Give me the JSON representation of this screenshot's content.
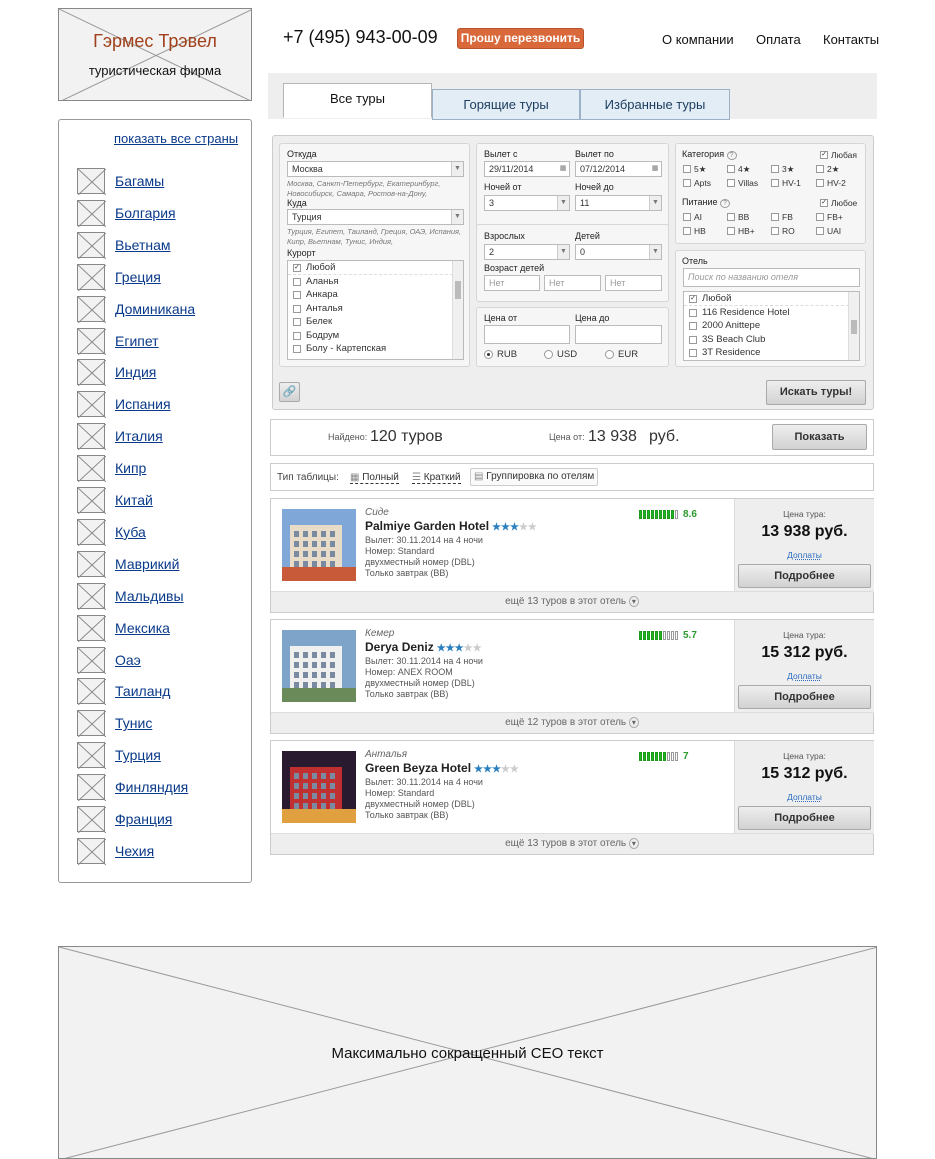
{
  "logo": {
    "title": "Гэрмес Трэвел",
    "subtitle": "туристическая фирма"
  },
  "header": {
    "phone": "+7 (495) 943-00-09",
    "callback_label": "Прошу перезвонить",
    "nav": [
      "О компании",
      "Оплата",
      "Контакты"
    ]
  },
  "sidebar": {
    "show_all_label": "показать все страны",
    "countries": [
      "Багамы",
      "Болгария",
      "Вьетнам",
      "Греция",
      "Доминикана",
      "Египет",
      "Индия",
      "Испания",
      "Италия",
      "Кипр",
      "Китай",
      "Куба",
      "Маврикий",
      "Мальдивы",
      "Мексика",
      "Оаэ",
      "Таиланд",
      "Тунис",
      "Турция",
      "Финляндия",
      "Франция",
      "Чехия"
    ]
  },
  "tabs": [
    "Все туры",
    "Горящие туры",
    "Избранные туры"
  ],
  "search": {
    "from_label": "Откуда",
    "from_value": "Москва",
    "from_hint": "Москва, Санкт-Петербург, Екатеринбург, Новосибирск, Самара, Ростов-на-Дону,",
    "to_label": "Куда",
    "to_value": "Турция",
    "to_hint": "Турция, Египет, Таиланд, Греция, ОАЭ, Испания, Кипр, Вьетнам, Тунис, Индия,",
    "resort_label": "Курорт",
    "resorts": [
      {
        "label": "Любой",
        "checked": true
      },
      {
        "label": "Аланья",
        "checked": false
      },
      {
        "label": "Анкара",
        "checked": false
      },
      {
        "label": "Анталья",
        "checked": false
      },
      {
        "label": "Белек",
        "checked": false
      },
      {
        "label": "Бодрум",
        "checked": false
      },
      {
        "label": "Болу - Картепская",
        "checked": false
      }
    ],
    "date_from_label": "Вылет с",
    "date_from": "29/11/2014",
    "date_to_label": "Вылет по",
    "date_to": "07/12/2014",
    "nights_from_label": "Ночей от",
    "nights_from": "3",
    "nights_to_label": "Ночей до",
    "nights_to": "11",
    "adults_label": "Взрослых",
    "adults": "2",
    "children_label": "Детей",
    "children": "0",
    "child_age_label": "Возраст детей",
    "child_age_placeholder": "Нет",
    "price_from_label": "Цена от",
    "price_to_label": "Цена до",
    "currencies": [
      {
        "label": "RUB",
        "selected": true
      },
      {
        "label": "USD",
        "selected": false
      },
      {
        "label": "EUR",
        "selected": false
      }
    ],
    "category_label": "Категория",
    "category_any": "Любая",
    "categories": [
      "5★",
      "4★",
      "3★",
      "2★",
      "Apts",
      "Villas",
      "HV-1",
      "HV-2"
    ],
    "meal_label": "Питание",
    "meal_any": "Любое",
    "meals": [
      "AI",
      "BB",
      "FB",
      "FB+",
      "HB",
      "HB+",
      "RO",
      "UAI"
    ],
    "hotel_label": "Отель",
    "hotel_placeholder": "Поиск по названию отеля",
    "hotels": [
      {
        "label": "Любой",
        "checked": true
      },
      {
        "label": "116 Residence Hotel",
        "checked": false
      },
      {
        "label": "2000 Anittepe",
        "checked": false
      },
      {
        "label": "3S Beach Club",
        "checked": false
      },
      {
        "label": "3T Residence",
        "checked": false
      }
    ],
    "search_button": "Искать туры!"
  },
  "summary": {
    "found_label": "Найдено:",
    "found_value": "120 туров",
    "price_from_label": "Цена от:",
    "price_from_value": "13 938",
    "currency": "руб.",
    "show_button": "Показать"
  },
  "table_type": {
    "label": "Тип таблицы:",
    "options": [
      "Полный",
      "Краткий",
      "Группировка по отелям"
    ]
  },
  "results": [
    {
      "city": "Сиде",
      "hotel": "Palmiye Garden Hotel",
      "stars": 3,
      "departure": "Вылет: 30.11.2014 на 4 ночи",
      "room": "Номер: Standard",
      "room_type": "двухместный номер (DBL)",
      "meal": "Только завтрак (BB)",
      "rating": "8.6",
      "rating_fill": 0.86,
      "price_label": "Цена тура:",
      "price": "13 938 руб.",
      "extras": "Доплаты",
      "details": "Подробнее",
      "more": "ещё 13 туров в этот отель"
    },
    {
      "city": "Кемер",
      "hotel": "Derya Deniz",
      "stars": 3,
      "departure": "Вылет: 30.11.2014 на 4 ночи",
      "room": "Номер: ANEX ROOM",
      "room_type": "двухместный номер (DBL)",
      "meal": "Только завтрак (BB)",
      "rating": "5.7",
      "rating_fill": 0.57,
      "price_label": "Цена тура:",
      "price": "15 312 руб.",
      "extras": "Доплаты",
      "details": "Подробнее",
      "more": "ещё 12 туров в этот отель"
    },
    {
      "city": "Анталья",
      "hotel": "Green Beyza Hotel",
      "stars": 3,
      "departure": "Вылет: 30.11.2014 на 4 ночи",
      "room": "Номер: Standard",
      "room_type": "двухместный номер (DBL)",
      "meal": "Только завтрак (BB)",
      "rating": "7",
      "rating_fill": 0.7,
      "price_label": "Цена тура:",
      "price": "15 312 руб.",
      "extras": "Доплаты",
      "details": "Подробнее",
      "more": "ещё 13 туров в этот отель"
    }
  ],
  "seo": {
    "text": "Максимально сокращенный СЕО текст"
  }
}
